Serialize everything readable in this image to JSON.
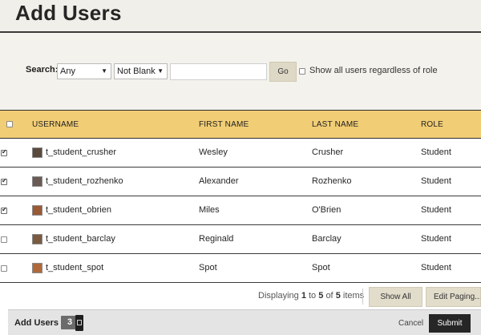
{
  "header": {
    "title": "Add Users"
  },
  "search": {
    "label": "Search:",
    "field_select": "Any",
    "operator_select": "Not Blank",
    "input_value": "",
    "go_label": "Go",
    "show_all_label": "Show all users regardless of role"
  },
  "table": {
    "columns": {
      "username": "USERNAME",
      "first_name": "FIRST NAME",
      "last_name": "LAST NAME",
      "role": "ROLE"
    },
    "rows": [
      {
        "username": "t_student_crusher",
        "first_name": "Wesley",
        "last_name": "Crusher",
        "role": "Student",
        "checked": true,
        "avatar_color": "#5a4a3e"
      },
      {
        "username": "t_student_rozhenko",
        "first_name": "Alexander",
        "last_name": "Rozhenko",
        "role": "Student",
        "checked": true,
        "avatar_color": "#6a5a55"
      },
      {
        "username": "t_student_obrien",
        "first_name": "Miles",
        "last_name": "O'Brien",
        "role": "Student",
        "checked": true,
        "avatar_color": "#9a5a35"
      },
      {
        "username": "t_student_barclay",
        "first_name": "Reginald",
        "last_name": "Barclay",
        "role": "Student",
        "checked": false,
        "avatar_color": "#7a5a40"
      },
      {
        "username": "t_student_spot",
        "first_name": "Spot",
        "last_name": "Spot",
        "role": "Student",
        "checked": false,
        "avatar_color": "#b06a3a"
      }
    ]
  },
  "pager": {
    "displaying": "Displaying",
    "from": "1",
    "to_word": "to",
    "to": "5",
    "of_word": "of",
    "total": "5",
    "items_word": "items",
    "show_all_label": "Show All",
    "edit_paging_label": "Edit Paging..."
  },
  "footer": {
    "title": "Add Users",
    "count": "3",
    "cancel_label": "Cancel",
    "submit_label": "Submit"
  },
  "colors": {
    "header_bg": "#f1efe9",
    "table_header_bg": "#f1cd75",
    "submit_bg": "#262626"
  }
}
